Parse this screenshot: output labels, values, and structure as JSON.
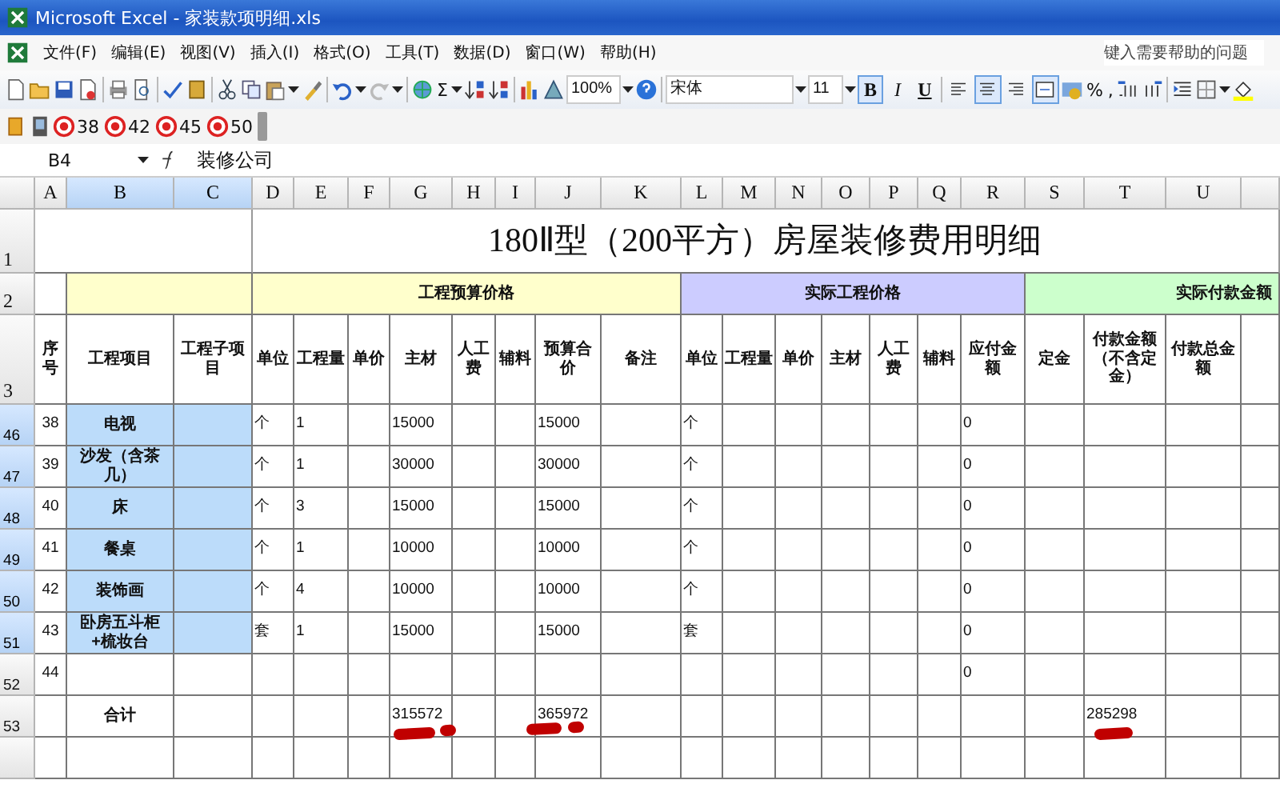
{
  "window": {
    "title": "Microsoft Excel - 家装款项明细.xls"
  },
  "menu": [
    "文件(F)",
    "编辑(E)",
    "视图(V)",
    "插入(I)",
    "格式(O)",
    "工具(T)",
    "数据(D)",
    "窗口(W)",
    "帮助(H)"
  ],
  "help_box": {
    "placeholder": "键入需要帮助的问题"
  },
  "toolbar": {
    "autosum": "Σ",
    "zoom": "100%",
    "font": "宋体",
    "size": "11",
    "percent": "%",
    "comma": ",",
    "format_buttons": [
      {
        "label": "B",
        "selected": true
      },
      {
        "label": "I",
        "selected": false
      },
      {
        "label": "U",
        "selected": false
      }
    ],
    "alignment": [
      {
        "kind": "left",
        "selected": false
      },
      {
        "kind": "center",
        "selected": true
      },
      {
        "kind": "right",
        "selected": false
      },
      {
        "kind": "merge",
        "selected": true
      }
    ]
  },
  "stamp_toolbar": [
    "38",
    "42",
    "45",
    "50"
  ],
  "formula_bar": {
    "name_box": "B4",
    "formula": "装修公司"
  },
  "header_row_numbers": [
    "1",
    "2",
    "3"
  ],
  "sheet_title": "180Ⅱ型（200平方）房屋装修费用明细",
  "column_groups": [
    {
      "columns": [
        {
          "letter": "A",
          "selected": false,
          "heading": "序号"
        }
      ]
    },
    {
      "color": "#ffffcc",
      "columns": [
        {
          "letter": "B",
          "selected": true,
          "heading": "工程项目"
        },
        {
          "letter": "C",
          "selected": true,
          "heading": "工程子项目"
        }
      ]
    },
    {
      "label": "工程预算价格",
      "color": "#ffffcc",
      "columns": [
        {
          "letter": "D",
          "selected": false,
          "heading": "单位"
        },
        {
          "letter": "E",
          "selected": false,
          "heading": "工程量"
        },
        {
          "letter": "F",
          "selected": false,
          "heading": "单价"
        },
        {
          "letter": "G",
          "selected": false,
          "heading": "主材"
        },
        {
          "letter": "H",
          "selected": false,
          "heading": "人工费"
        },
        {
          "letter": "I",
          "selected": false,
          "heading": "辅料"
        },
        {
          "letter": "J",
          "selected": false,
          "heading": "预算合价"
        },
        {
          "letter": "K",
          "selected": false,
          "heading": "备注"
        }
      ]
    },
    {
      "label": "实际工程价格",
      "color": "#ccccff",
      "columns": [
        {
          "letter": "L",
          "selected": false,
          "heading": "单位"
        },
        {
          "letter": "M",
          "selected": false,
          "heading": "工程量"
        },
        {
          "letter": "N",
          "selected": false,
          "heading": "单价"
        },
        {
          "letter": "O",
          "selected": false,
          "heading": "主材"
        },
        {
          "letter": "P",
          "selected": false,
          "heading": "人工费"
        },
        {
          "letter": "Q",
          "selected": false,
          "heading": "辅料"
        },
        {
          "letter": "R",
          "selected": false,
          "heading": "应付金额"
        }
      ]
    },
    {
      "label": "实际付款金额",
      "color": "#ccffcc",
      "columns": [
        {
          "letter": "S",
          "selected": false,
          "heading": "定金"
        },
        {
          "letter": "T",
          "selected": false,
          "heading": "付款金额（不含定金）"
        },
        {
          "letter": "U",
          "selected": false,
          "heading": "付款总金额"
        }
      ]
    }
  ],
  "rows": [
    {
      "number": "46",
      "selected": true,
      "cells": [
        "38",
        "电视",
        null,
        "个",
        "1",
        null,
        "15000",
        null,
        null,
        "15000",
        null,
        "个",
        null,
        null,
        null,
        null,
        null,
        "0",
        null,
        null,
        null
      ]
    },
    {
      "number": "47",
      "selected": true,
      "cells": [
        "39",
        "沙发（含茶几）",
        null,
        "个",
        "1",
        null,
        "30000",
        null,
        null,
        "30000",
        null,
        "个",
        null,
        null,
        null,
        null,
        null,
        "0",
        null,
        null,
        null
      ]
    },
    {
      "number": "48",
      "selected": true,
      "cells": [
        "40",
        "床",
        null,
        "个",
        "3",
        null,
        "15000",
        null,
        null,
        "15000",
        null,
        "个",
        null,
        null,
        null,
        null,
        null,
        "0",
        null,
        null,
        null
      ]
    },
    {
      "number": "49",
      "selected": true,
      "cells": [
        "41",
        "餐桌",
        null,
        "个",
        "1",
        null,
        "10000",
        null,
        null,
        "10000",
        null,
        "个",
        null,
        null,
        null,
        null,
        null,
        "0",
        null,
        null,
        null
      ]
    },
    {
      "number": "50",
      "selected": true,
      "cells": [
        "42",
        "装饰画",
        null,
        "个",
        "4",
        null,
        "10000",
        null,
        null,
        "10000",
        null,
        "个",
        null,
        null,
        null,
        null,
        null,
        "0",
        null,
        null,
        null
      ]
    },
    {
      "number": "51",
      "selected": true,
      "cells": [
        "43",
        "卧房五斗柜+梳妆台",
        null,
        "套",
        "1",
        null,
        "15000",
        null,
        null,
        "15000",
        null,
        "套",
        null,
        null,
        null,
        null,
        null,
        "0",
        null,
        null,
        null
      ]
    },
    {
      "number": "52",
      "selected": false,
      "cells": [
        "44",
        null,
        null,
        null,
        null,
        null,
        null,
        null,
        null,
        null,
        null,
        null,
        null,
        null,
        null,
        null,
        null,
        "0",
        null,
        null,
        null
      ]
    },
    {
      "number": "53",
      "selected": false,
      "cells": [
        null,
        "合计",
        null,
        null,
        null,
        null,
        "315572",
        null,
        null,
        "365972",
        null,
        null,
        null,
        null,
        null,
        null,
        null,
        null,
        null,
        "285298",
        null
      ]
    }
  ]
}
